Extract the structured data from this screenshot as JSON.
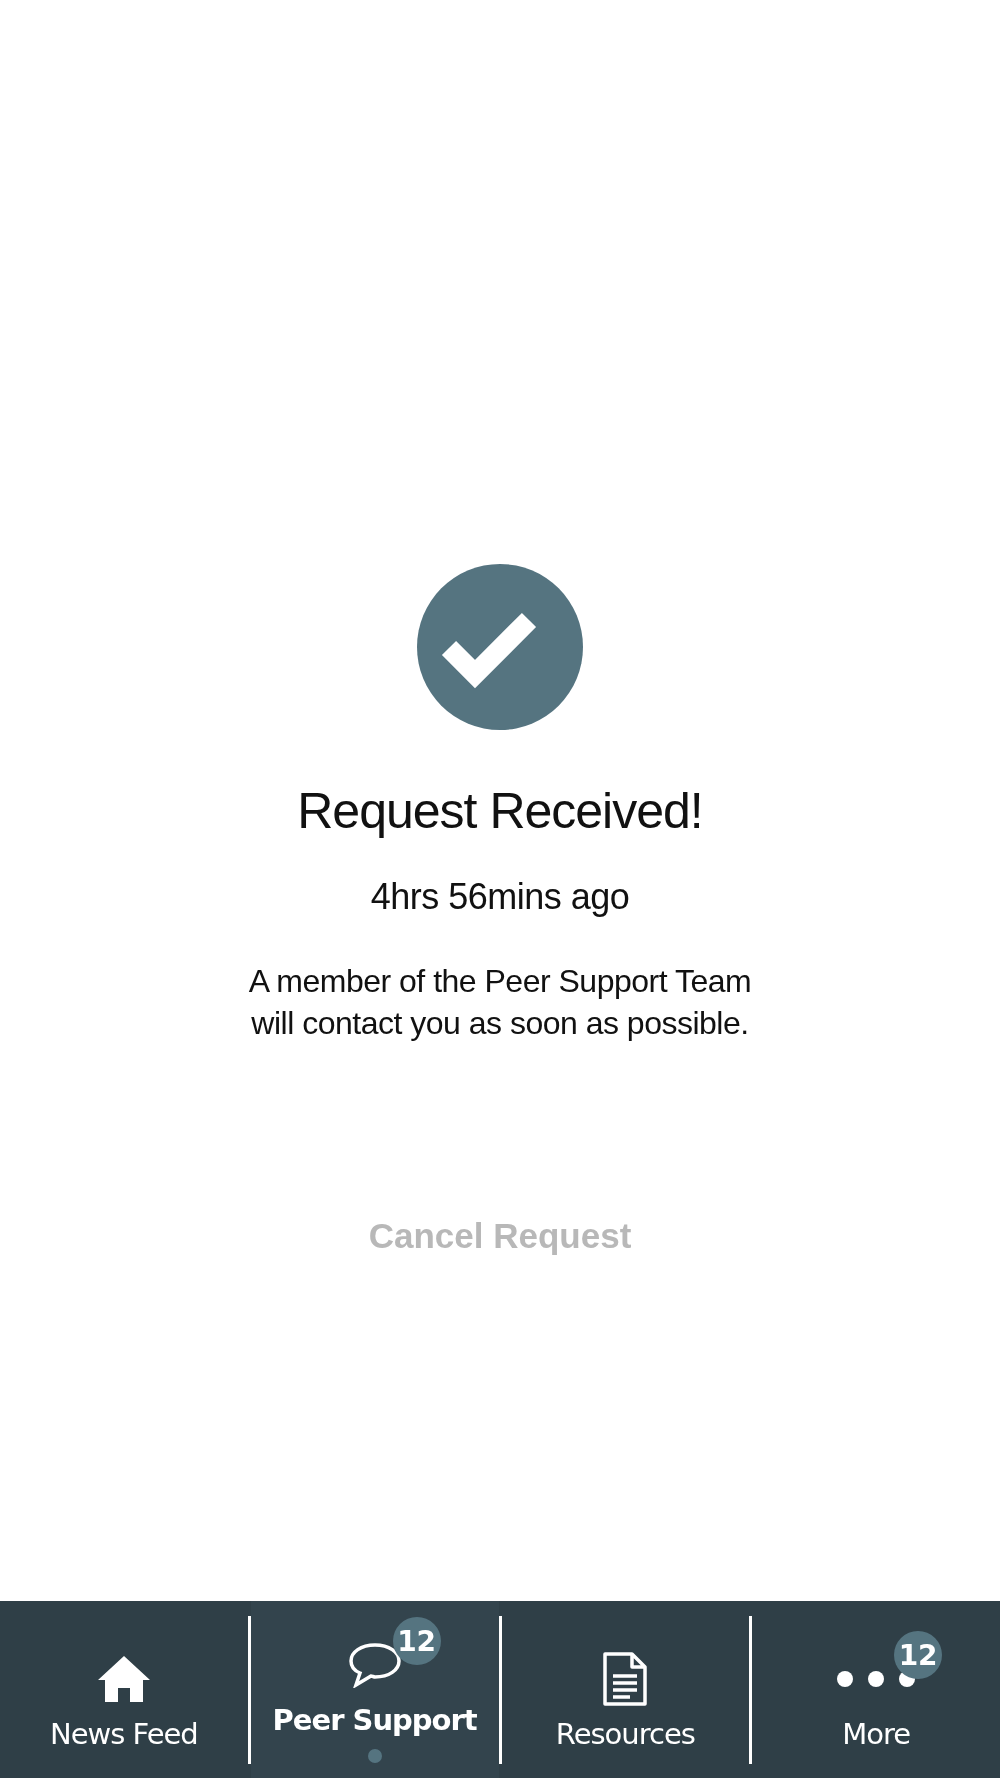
{
  "status": {
    "title": "Request Received!",
    "time": "4hrs 56mins ago",
    "message_lines": [
      "A member of the Peer Support Team",
      "will contact you as soon as possible."
    ]
  },
  "cancel_button": "Cancel Request",
  "tabs": [
    {
      "label": "News Feed",
      "kind": "home",
      "selected": false
    },
    {
      "label": "Peer Support",
      "kind": "chat",
      "selected": true,
      "badge": "12"
    },
    {
      "label": "Resources",
      "kind": "document",
      "selected": false
    },
    {
      "label": "More",
      "kind": "dots",
      "selected": false,
      "badge": "12"
    }
  ]
}
